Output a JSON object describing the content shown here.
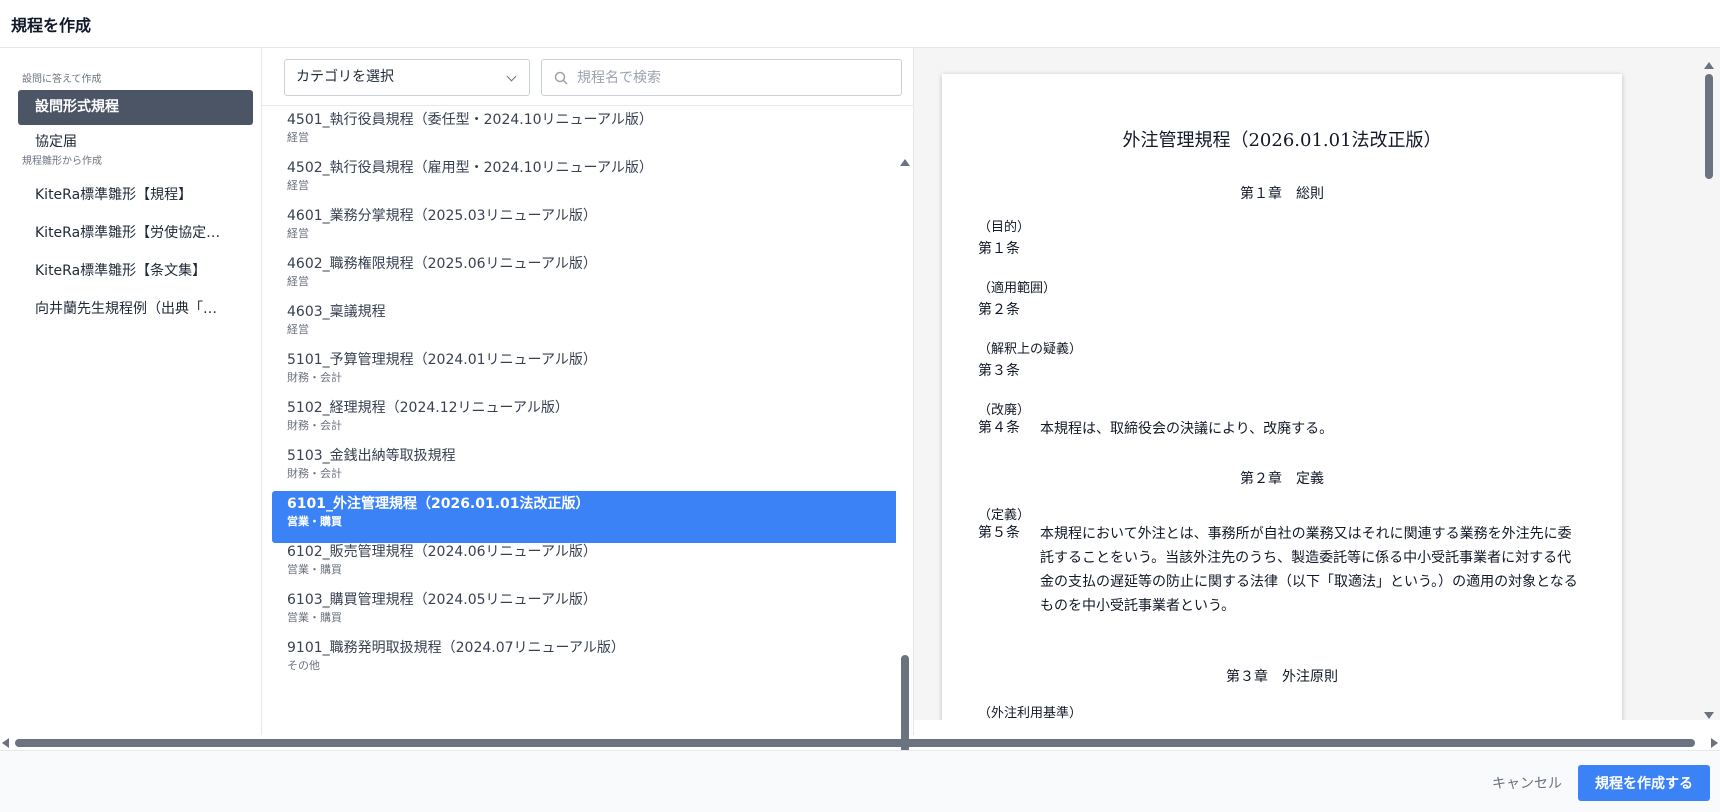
{
  "header": {
    "title": "規程を作成"
  },
  "sidebar": {
    "section_questions": "設問に答えて作成",
    "items_questions": [
      {
        "label": "設問形式規程"
      },
      {
        "label": "協定届"
      }
    ],
    "section_templates": "規程雛形から作成",
    "items_templates": [
      {
        "label": "KiteRa標準雛形【規程】"
      },
      {
        "label": "KiteRa標準雛形【労使協定…"
      },
      {
        "label": "KiteRa標準雛形【条文集】"
      },
      {
        "label": "向井蘭先生規程例（出典「…"
      }
    ]
  },
  "filters": {
    "category_value": "カテゴリを選択",
    "search_placeholder": "規程名で検索",
    "search_icon": "search-icon",
    "dropdown_icon": "chevron-down-icon"
  },
  "list": {
    "items": [
      {
        "name": "4501_執行役員規程（委任型・2024.10リニューアル版）",
        "category": "経営"
      },
      {
        "name": "4502_執行役員規程（雇用型・2024.10リニューアル版）",
        "category": "経営"
      },
      {
        "name": "4601_業務分掌規程（2025.03リニューアル版）",
        "category": "経営"
      },
      {
        "name": "4602_職務権限規程（2025.06リニューアル版）",
        "category": "経営"
      },
      {
        "name": "4603_稟議規程",
        "category": "経営"
      },
      {
        "name": "5101_予算管理規程（2024.01リニューアル版）",
        "category": "財務・会計"
      },
      {
        "name": "5102_経理規程（2024.12リニューアル版）",
        "category": "財務・会計"
      },
      {
        "name": "5103_金銭出納等取扱規程",
        "category": "財務・会計"
      },
      {
        "name": "6101_外注管理規程（2026.01.01法改正版）",
        "category": "営業・購買"
      },
      {
        "name": "6102_販売管理規程（2024.06リニューアル版）",
        "category": "営業・購買"
      },
      {
        "name": "6103_購買管理規程（2024.05リニューアル版）",
        "category": "営業・購買"
      },
      {
        "name": "9101_職務発明取扱規程（2024.07リニューアル版）",
        "category": "その他"
      }
    ],
    "selected_index": 8
  },
  "preview": {
    "title": "外注管理規程（2026.01.01法改正版）",
    "chapter1": "第１章　総則",
    "heading_purpose": "（目的）",
    "art1": "第１条",
    "heading_scope": "（適用範囲）",
    "art2": "第２条",
    "heading_doubt": "（解釈上の疑義）",
    "art3": "第３条",
    "heading_revision": "（改廃）",
    "art4_num": "第４条",
    "art4_body": "本規程は、取締役会の決議により、改廃する。",
    "chapter2": "第２章　定義",
    "heading_definition": "（定義）",
    "art5_num": "第５条",
    "art5_body": "本規程において外注とは、事務所が自社の業務又はそれに関連する業務を外注先に委託することをいう。当該外注先のうち、製造委託等に係る中小受託事業者に対する代金の支払の遅延等の防止に関する法律（以下「取適法」という。）の適用の対象となるものを中小受託事業者という。",
    "chapter3": "第３章　外注原則",
    "heading_criteria": "（外注利用基準）"
  },
  "footer": {
    "cancel_label": "キャンセル",
    "create_label": "規程を作成する"
  },
  "colors": {
    "accent": "#3b82f6",
    "sidebar_active": "#4b5566"
  }
}
